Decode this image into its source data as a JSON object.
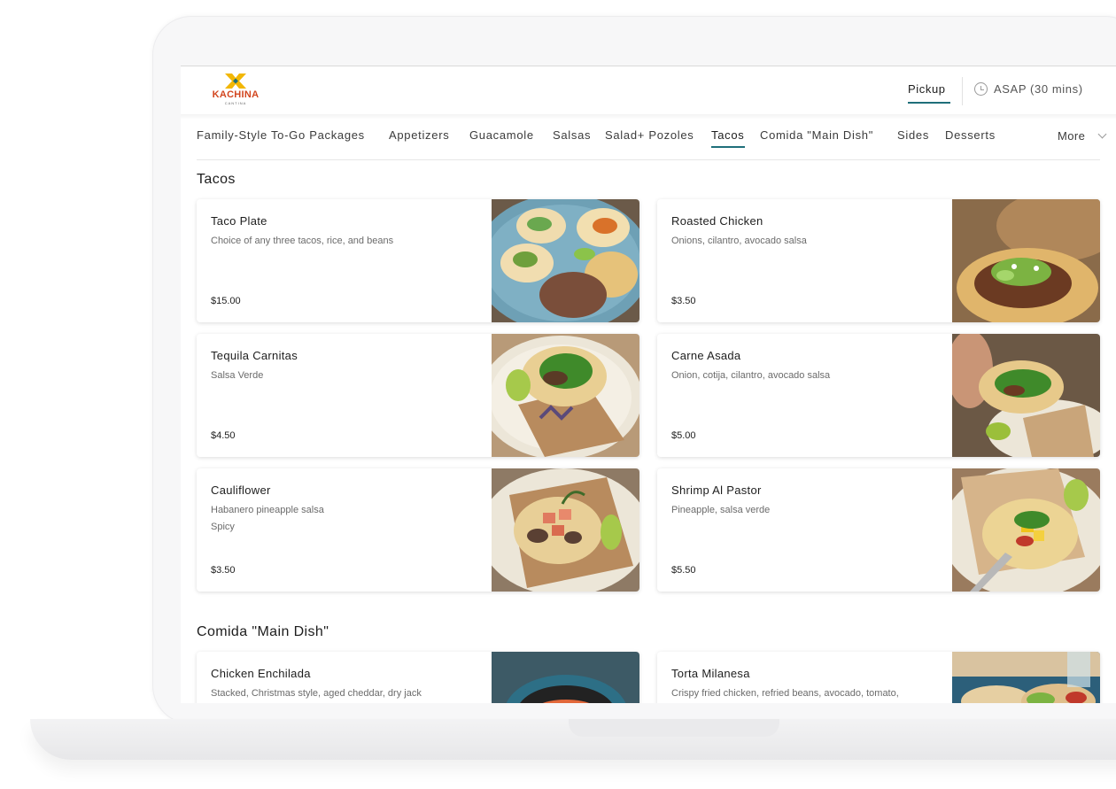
{
  "brand": {
    "name": "KACHINA",
    "tagline": "CANTINA",
    "colors": {
      "orange": "#d2461f",
      "yellow": "#f2b705",
      "teal": "#1f6f7a"
    }
  },
  "header": {
    "mode_label": "Pickup",
    "time_label": "ASAP (30 mins)",
    "time_icon": "clock-icon"
  },
  "nav": {
    "items": [
      {
        "label": "Family-Style To-Go Packages"
      },
      {
        "label": "Appetizers"
      },
      {
        "label": "Guacamole"
      },
      {
        "label": "Salsas"
      },
      {
        "label": "Salad+ Pozoles"
      },
      {
        "label": "Tacos",
        "active": true
      },
      {
        "label": "Comida \"Main Dish\""
      },
      {
        "label": "Sides"
      },
      {
        "label": "Desserts"
      }
    ],
    "more_label": "More",
    "more_icon": "chevron-down-icon"
  },
  "sections": [
    {
      "title": "Tacos",
      "items": [
        {
          "name": "Taco Plate",
          "description": "Choice of any three tacos, rice, and beans",
          "price": "$15.00"
        },
        {
          "name": "Roasted Chicken",
          "description": "Onions, cilantro, avocado salsa",
          "price": "$3.50"
        },
        {
          "name": "Tequila Carnitas",
          "description": "Salsa Verde",
          "price": "$4.50"
        },
        {
          "name": "Carne Asada",
          "description": "Onion, cotija, cilantro, avocado salsa",
          "price": "$5.00"
        },
        {
          "name": "Cauliflower",
          "description": "Habanero pineapple salsa",
          "tag": "Spicy",
          "price": "$3.50"
        },
        {
          "name": "Shrimp Al Pastor",
          "description": "Pineapple, salsa verde",
          "price": "$5.50"
        }
      ]
    },
    {
      "title": "Comida \"Main Dish\"",
      "items": [
        {
          "name": "Chicken Enchilada",
          "description": "Stacked, Christmas style, aged cheddar, dry jack"
        },
        {
          "name": "Torta Milanesa",
          "description": "Crispy fried chicken, refried beans, avocado, tomato,"
        }
      ]
    }
  ]
}
